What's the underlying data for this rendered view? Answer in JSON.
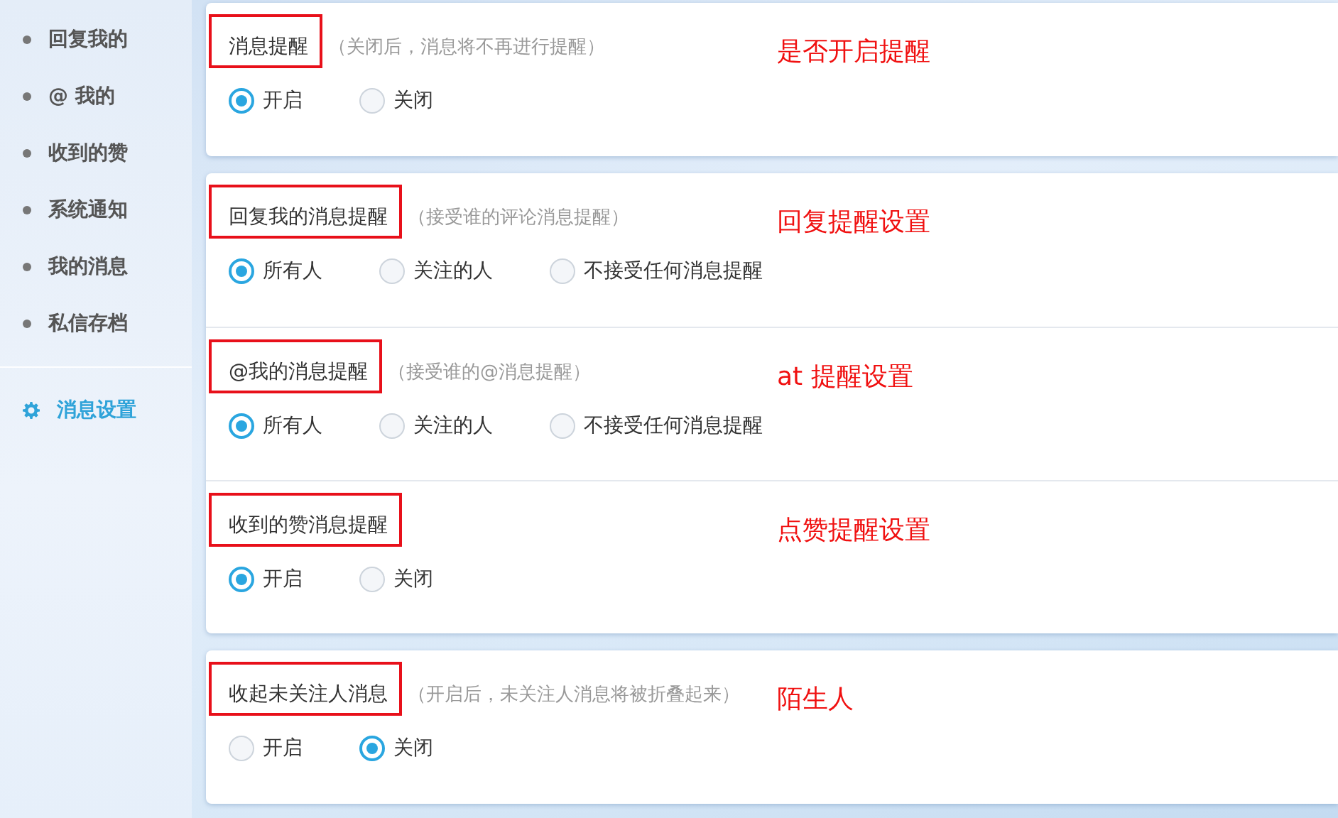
{
  "sidebar": {
    "items": [
      {
        "label": "回复我的",
        "selected": false,
        "kind": "bullet"
      },
      {
        "label": "@ 我的",
        "selected": false,
        "kind": "bullet"
      },
      {
        "label": "收到的赞",
        "selected": false,
        "kind": "bullet"
      },
      {
        "label": "系统通知",
        "selected": false,
        "kind": "bullet"
      },
      {
        "label": "我的消息",
        "selected": false,
        "kind": "bullet"
      },
      {
        "label": "私信存档",
        "selected": false,
        "kind": "bullet"
      },
      {
        "label": "消息设置",
        "selected": true,
        "kind": "gear"
      }
    ]
  },
  "cards": [
    {
      "sections": [
        {
          "title": "消息提醒",
          "hint": "（关闭后，消息将不再进行提醒）",
          "annotation": "是否开启提醒",
          "options": [
            {
              "label": "开启",
              "selected": true
            },
            {
              "label": "关闭",
              "selected": false
            }
          ]
        }
      ]
    },
    {
      "sections": [
        {
          "title": "回复我的消息提醒",
          "hint": "（接受谁的评论消息提醒）",
          "annotation": "回复提醒设置",
          "options": [
            {
              "label": "所有人",
              "selected": true
            },
            {
              "label": "关注的人",
              "selected": false
            },
            {
              "label": "不接受任何消息提醒",
              "selected": false
            }
          ]
        },
        {
          "title": "@我的消息提醒",
          "hint": "（接受谁的@消息提醒）",
          "annotation": "at 提醒设置",
          "options": [
            {
              "label": "所有人",
              "selected": true
            },
            {
              "label": "关注的人",
              "selected": false
            },
            {
              "label": "不接受任何消息提醒",
              "selected": false
            }
          ]
        },
        {
          "title": "收到的赞消息提醒",
          "annotation": "点赞提醒设置",
          "options": [
            {
              "label": "开启",
              "selected": true
            },
            {
              "label": "关闭",
              "selected": false
            }
          ]
        }
      ]
    },
    {
      "sections": [
        {
          "title": "收起未关注人消息",
          "hint": "（开启后，未关注人消息将被折叠起来）",
          "annotation": "陌生人",
          "options": [
            {
              "label": "开启",
              "selected": false
            },
            {
              "label": "关闭",
              "selected": true
            }
          ]
        }
      ]
    }
  ]
}
